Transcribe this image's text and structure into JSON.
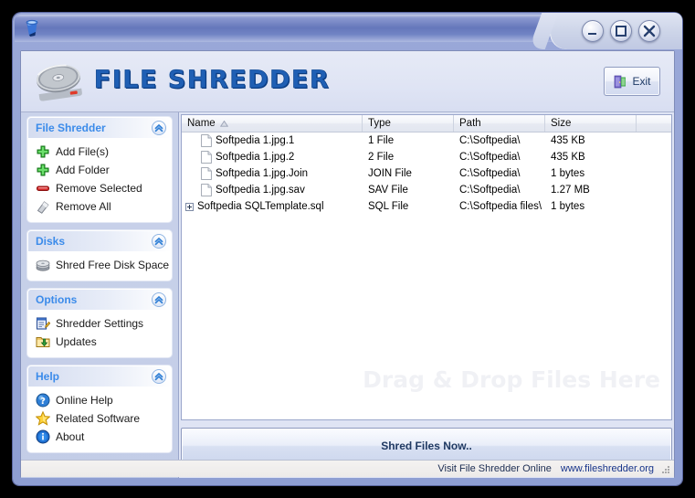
{
  "window": {
    "app_icon": "shredder-bin-icon",
    "buttons": {
      "minimize": "minimize-icon",
      "maximize": "maximize-icon",
      "close": "close-icon"
    }
  },
  "header": {
    "logo_icon": "hard-drive-icon",
    "title": "FILE SHREDDER",
    "exit_label": "Exit",
    "exit_icon": "door-exit-icon",
    "title_color": "#1f5fb4"
  },
  "sidebar": {
    "panels": [
      {
        "title": "File Shredder",
        "items": [
          {
            "label": "Add File(s)",
            "icon": "plus-green-icon"
          },
          {
            "label": "Add Folder",
            "icon": "plus-green-icon"
          },
          {
            "label": "Remove Selected",
            "icon": "minus-red-icon"
          },
          {
            "label": "Remove All",
            "icon": "eraser-icon"
          }
        ]
      },
      {
        "title": "Disks",
        "items": [
          {
            "label": "Shred Free Disk Space",
            "icon": "disks-stack-icon"
          }
        ]
      },
      {
        "title": "Options",
        "items": [
          {
            "label": "Shredder Settings",
            "icon": "settings-pencil-icon"
          },
          {
            "label": "Updates",
            "icon": "updates-folder-icon"
          }
        ]
      },
      {
        "title": "Help",
        "items": [
          {
            "label": "Online Help",
            "icon": "question-circle-icon"
          },
          {
            "label": "Related Software",
            "icon": "star-icon"
          },
          {
            "label": "About",
            "icon": "info-circle-icon"
          }
        ]
      }
    ]
  },
  "filelist": {
    "columns": [
      "Name",
      "Type",
      "Path",
      "Size"
    ],
    "sort_column": "Name",
    "sort_direction": "ascending",
    "rows": [
      {
        "name": "Softpedia 1.jpg.1",
        "type": "1 File",
        "path": "C:\\Softpedia\\",
        "size": "435 KB",
        "expandable": false
      },
      {
        "name": "Softpedia 1.jpg.2",
        "type": "2 File",
        "path": "C:\\Softpedia\\",
        "size": "435 KB",
        "expandable": false
      },
      {
        "name": "Softpedia 1.jpg.Join",
        "type": "JOIN File",
        "path": "C:\\Softpedia\\",
        "size": "1 bytes",
        "expandable": false
      },
      {
        "name": "Softpedia 1.jpg.sav",
        "type": "SAV File",
        "path": "C:\\Softpedia\\",
        "size": "1.27 MB",
        "expandable": false
      },
      {
        "name": "Softpedia SQLTemplate.sql",
        "type": "SQL File",
        "path": "C:\\Softpedia files\\",
        "size": "1 bytes",
        "expandable": true
      }
    ],
    "watermark": "Drag & Drop Files Here"
  },
  "actions": {
    "shred_label": "Shred Files Now.."
  },
  "statusbar": {
    "text": "Visit File Shredder Online",
    "link": "www.fileshredder.org"
  }
}
